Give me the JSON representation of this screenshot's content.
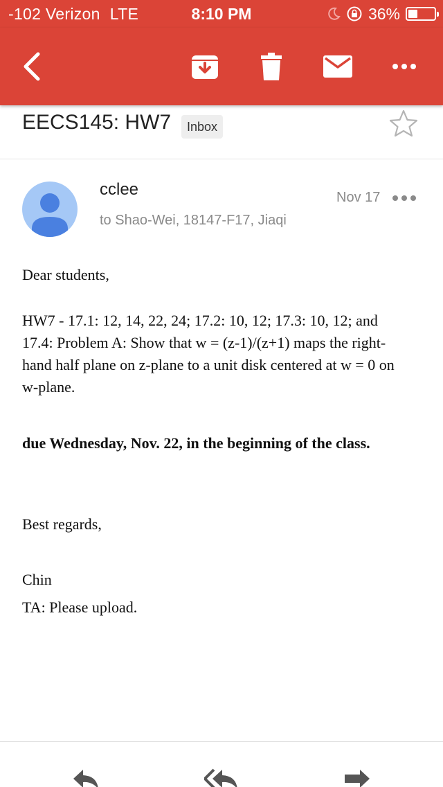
{
  "status_bar": {
    "carrier": "-102 Verizon",
    "network": "LTE",
    "time": "8:10 PM",
    "battery_text": "36%",
    "battery_level": 0.36,
    "icons": [
      "moon-icon",
      "rotation-lock-icon",
      "battery-icon"
    ]
  },
  "toolbar": {
    "icons": [
      "back-icon",
      "archive-icon",
      "trash-icon",
      "mail-icon",
      "more-icon"
    ]
  },
  "email": {
    "subject": "EECS145: HW7",
    "label": "Inbox",
    "sender": "cclee",
    "recipients": "to Shao-Wei, 18147-F17, Jiaqi",
    "date": "Nov 17"
  },
  "message": {
    "greeting": "Dear students,",
    "homework": "HW7 - 17.1: 12, 14, 22, 24; 17.2: 10, 12; 17.3: 10, 12; and 17.4: Problem A: Show that w = (z-1)/(z+1) maps the right-hand half plane on z-plane to a unit disk centered at w = 0 on w-plane.",
    "due": "due Wednesday, Nov. 22, in the beginning of the class.",
    "closing": "Best regards,",
    "signature": "Chin",
    "note": "TA: Please upload."
  },
  "bottom_bar": {
    "icons": [
      "reply-icon",
      "reply-all-icon",
      "forward-icon"
    ]
  },
  "colors": {
    "header": "#db4437",
    "avatar_bg": "#a5c8f6",
    "avatar_fg": "#4a80e0",
    "icon_gray": "#555555"
  }
}
